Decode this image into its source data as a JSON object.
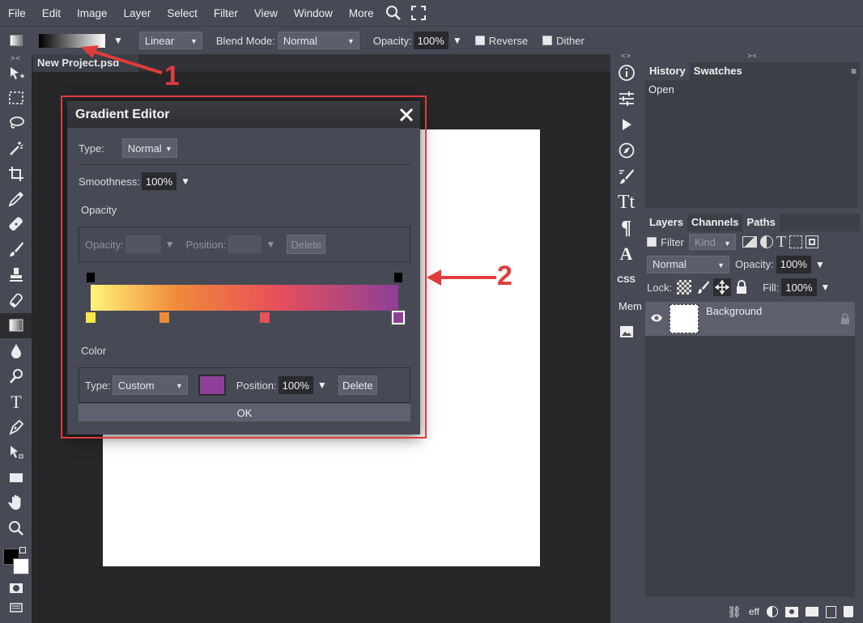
{
  "menubar": {
    "items": [
      "File",
      "Edit",
      "Image",
      "Layer",
      "Select",
      "Filter",
      "View",
      "Window",
      "More"
    ]
  },
  "options": {
    "gradient_type": "Linear",
    "blend_label": "Blend Mode:",
    "blend_value": "Normal",
    "opacity_label": "Opacity:",
    "opacity_value": "100%",
    "reverse_label": "Reverse",
    "dither_label": "Dither"
  },
  "document": {
    "tab_title": "New Project.psd"
  },
  "dialog": {
    "title": "Gradient Editor",
    "type_label": "Type:",
    "type_value": "Normal",
    "smoothness_label": "Smoothness:",
    "smoothness_value": "100%",
    "opacity_section": "Opacity",
    "opacity_label": "Opacity:",
    "position_label": "Position:",
    "delete_label": "Delete",
    "color_section": "Color",
    "color_type_label": "Type:",
    "color_type_value": "Custom",
    "color_position_label": "Position:",
    "color_position_value": "100%",
    "color_delete_label": "Delete",
    "ok_label": "OK",
    "gradient_colors": [
      "#fff47a",
      "#ef8a3a",
      "#e8505a",
      "#8e3f97"
    ],
    "color_stop_colors": [
      "#f7e64a",
      "#ef8a3a",
      "#e8505a",
      "#8e3f97"
    ],
    "selected_color": "#8e3f97"
  },
  "annotations": {
    "one": "1",
    "two": "2"
  },
  "history": {
    "tabs": [
      "History",
      "Swatches"
    ],
    "items": [
      "Open"
    ]
  },
  "layers": {
    "tabs": [
      "Layers",
      "Channels",
      "Paths"
    ],
    "filter_label": "Filter",
    "kind_value": "Kind",
    "blend_value": "Normal",
    "opacity_label": "Opacity:",
    "opacity_value": "100%",
    "lock_label": "Lock:",
    "fill_label": "Fill:",
    "fill_value": "100%",
    "layer_name": "Background"
  },
  "midtools": {
    "css_label": "CSS",
    "mem_label": "Mem"
  },
  "footer": {
    "eff_label": "eff"
  }
}
